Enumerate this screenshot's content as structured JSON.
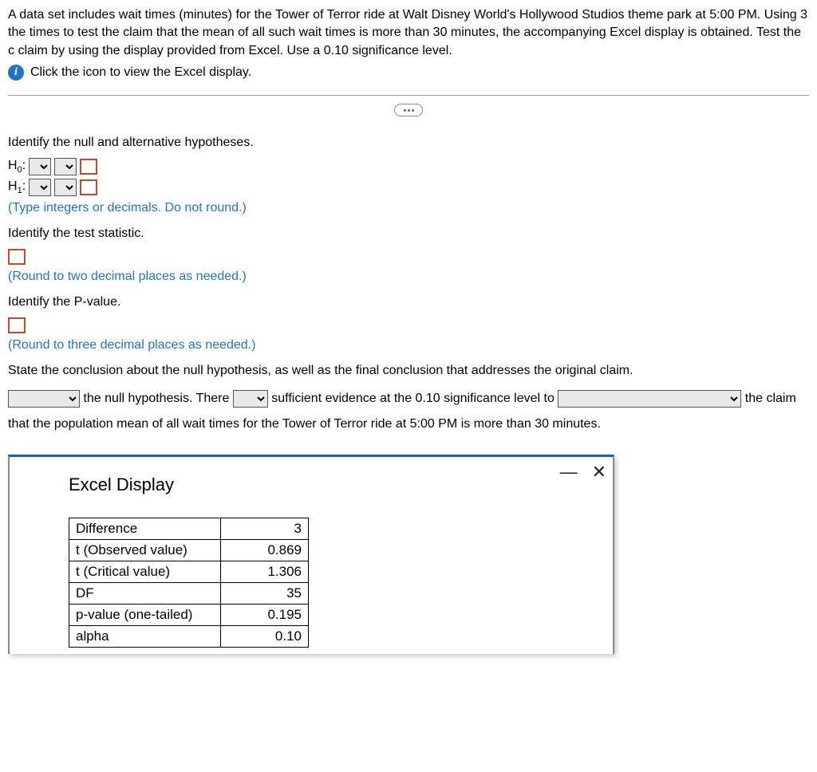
{
  "intro": "A data set includes wait times (minutes) for the Tower of Terror ride at Walt Disney World's Hollywood Studios theme park at 5:00 PM. Using 3 the times to test the claim that the mean of all such wait times is more than 30 minutes, the accompanying Excel display is obtained. Test the c claim by using the display provided from Excel. Use a 0.10 significance level.",
  "info_link": "Click the icon to view the Excel display.",
  "q1": "Identify the null and alternative hypotheses.",
  "h0_label": "H",
  "h0_sub": "0",
  "h1_label": "H",
  "h1_sub": "1",
  "colon": ":",
  "hyp_hint": "(Type integers or decimals. Do not round.)",
  "q2": "Identify the test statistic.",
  "ts_hint": "(Round to two decimal places as needed.)",
  "q3": "Identify the P-value.",
  "pv_hint": "(Round to three decimal places as needed.)",
  "q4": "State the conclusion about the null hypothesis, as well as the final conclusion that addresses the original claim.",
  "conc_part1": " the null hypothesis. There ",
  "conc_part2": " sufficient evidence at the 0.10 significance level to ",
  "conc_part3": " the claim that the population mean of all wait times for the Tower of Terror ride at 5:00 PM is more than 30 minutes.",
  "modal": {
    "title": "Excel Display",
    "rows": [
      {
        "label": "Difference",
        "value": "3"
      },
      {
        "label": "t (Observed value)",
        "value": "0.869"
      },
      {
        "label": "t (Critical value)",
        "value": "1.306"
      },
      {
        "label": "DF",
        "value": "35"
      },
      {
        "label": "p-value (one-tailed)",
        "value": "0.195"
      },
      {
        "label": "alpha",
        "value": "0.10"
      }
    ]
  }
}
